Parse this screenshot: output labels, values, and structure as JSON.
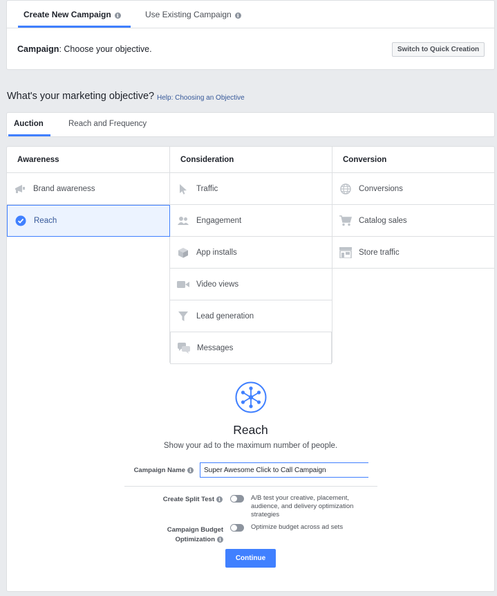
{
  "top_tabs": [
    {
      "label": "Create New Campaign",
      "active": true
    },
    {
      "label": "Use Existing Campaign",
      "active": false
    }
  ],
  "campaign": {
    "label": "Campaign",
    "text": ": Choose your objective."
  },
  "quick_creation_button": "Switch to Quick Creation",
  "objective_heading": "What's your marketing objective?",
  "objective_help": "Help: Choosing an Objective",
  "buying_tabs": [
    {
      "label": "Auction",
      "active": true
    },
    {
      "label": "Reach and Frequency",
      "active": false
    }
  ],
  "columns": [
    {
      "name": "Awareness",
      "items": [
        {
          "label": "Brand awareness",
          "icon": "megaphone-icon"
        },
        {
          "label": "Reach",
          "icon": "check-circle-icon",
          "selected": true
        }
      ]
    },
    {
      "name": "Consideration",
      "items": [
        {
          "label": "Traffic",
          "icon": "cursor-icon"
        },
        {
          "label": "Engagement",
          "icon": "people-icon"
        },
        {
          "label": "App installs",
          "icon": "box-icon"
        },
        {
          "label": "Video views",
          "icon": "video-camera-icon"
        },
        {
          "label": "Lead generation",
          "icon": "funnel-icon"
        },
        {
          "label": "Messages",
          "icon": "chat-bubbles-icon"
        }
      ]
    },
    {
      "name": "Conversion",
      "items": [
        {
          "label": "Conversions",
          "icon": "globe-icon"
        },
        {
          "label": "Catalog sales",
          "icon": "cart-icon"
        },
        {
          "label": "Store traffic",
          "icon": "store-icon"
        }
      ]
    }
  ],
  "detail": {
    "title": "Reach",
    "description": "Show your ad to the maximum number of people."
  },
  "form": {
    "campaign_name_label": "Campaign Name",
    "campaign_name_value": "Super Awesome Click to Call Campaign",
    "split_test_label": "Create Split Test",
    "split_test_desc_1": "A/B test your creative, placement,",
    "split_test_desc_2": "audience, and delivery optimization",
    "split_test_desc_3": "strategies",
    "budget_label_1": "Campaign Budget",
    "budget_label_2": "Optimization",
    "budget_desc": "Optimize budget across ad sets",
    "continue_label": "Continue"
  },
  "colors": {
    "accent": "#4080ff",
    "link": "#365899",
    "background": "#e9ebee"
  }
}
